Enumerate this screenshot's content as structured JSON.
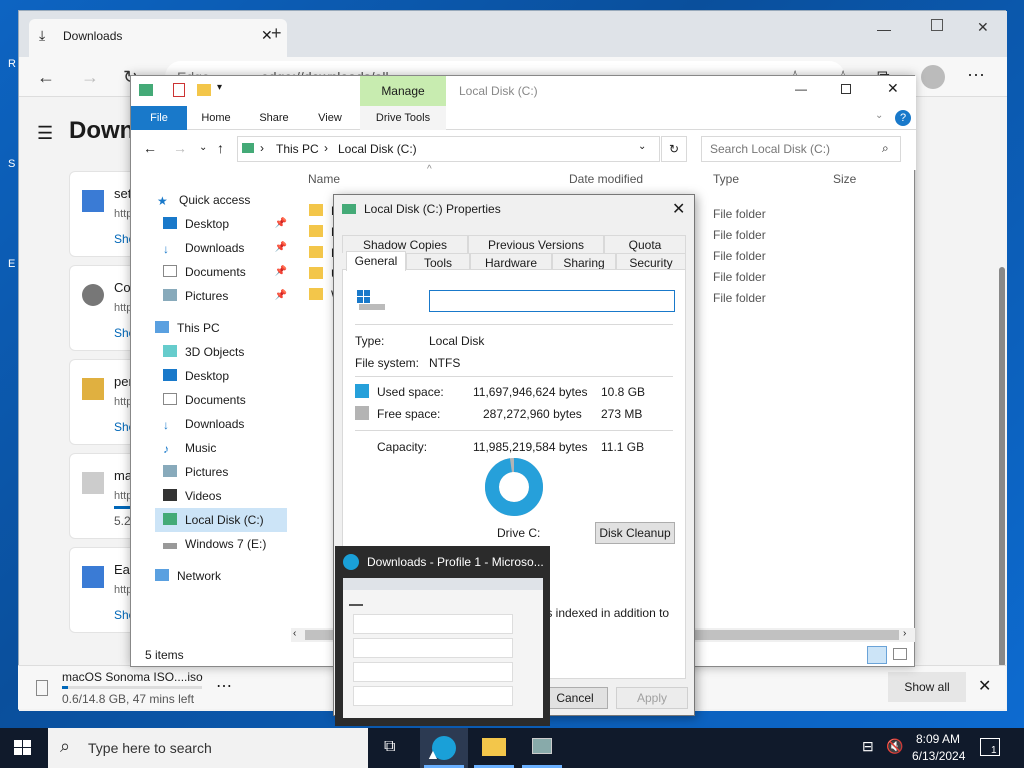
{
  "desktop": {
    "edge_letters": [
      "R",
      "S",
      "E"
    ]
  },
  "edge": {
    "tab_title": "Downloads",
    "address_prefix": "Edge",
    "address_url": "edge://downloads/all",
    "page_heading": "Down",
    "downloads": [
      {
        "name": "set",
        "url": "http",
        "link": "Sho"
      },
      {
        "name": "Co",
        "url": "http",
        "link": "Sho"
      },
      {
        "name": "per",
        "url": "http",
        "link": "Sho"
      },
      {
        "name": "ma",
        "url": "http",
        "link": "5.2"
      },
      {
        "name": "Ea",
        "url": "http",
        "link": "Sho"
      }
    ],
    "download_bar": {
      "file_name": "macOS Sonoma ISO....iso",
      "progress_text": "0.6/14.8 GB, 47 mins left",
      "progress_fraction": 0.04,
      "show_all": "Show all"
    }
  },
  "explorer": {
    "manage_label": "Manage",
    "window_title": "Local Disk (C:)",
    "ribbon_tabs": [
      "File",
      "Home",
      "Share",
      "View",
      "Drive Tools"
    ],
    "breadcrumb": [
      "This PC",
      "Local Disk (C:)"
    ],
    "search_placeholder": "Search Local Disk (C:)",
    "columns": {
      "name": "Name",
      "date": "Date modified",
      "type": "Type",
      "size": "Size"
    },
    "files": [
      {
        "name": "P",
        "type": "File folder"
      },
      {
        "name": "P",
        "type": "File folder"
      },
      {
        "name": "P",
        "type": "File folder"
      },
      {
        "name": "U",
        "type": "File folder"
      },
      {
        "name": "W",
        "type": "File folder"
      }
    ],
    "nav": {
      "quick_access": "Quick access",
      "quick_items": [
        "Desktop",
        "Downloads",
        "Documents",
        "Pictures"
      ],
      "this_pc": "This PC",
      "pc_items": [
        "3D Objects",
        "Desktop",
        "Documents",
        "Downloads",
        "Music",
        "Pictures",
        "Videos",
        "Local Disk (C:)",
        "Windows 7 (E:)"
      ],
      "network": "Network"
    },
    "status": "5 items"
  },
  "properties": {
    "title": "Local Disk (C:) Properties",
    "tabs_top": [
      "Shadow Copies",
      "Previous Versions",
      "Quota"
    ],
    "tabs_bottom": [
      "General",
      "Tools",
      "Hardware",
      "Sharing",
      "Security"
    ],
    "label_value": "",
    "type_label": "Type:",
    "type_value": "Local Disk",
    "fs_label": "File system:",
    "fs_value": "NTFS",
    "used_label": "Used space:",
    "used_bytes": "11,697,946,624 bytes",
    "used_gb": "10.8 GB",
    "free_label": "Free space:",
    "free_bytes": "287,272,960 bytes",
    "free_gb": "273 MB",
    "capacity_label": "Capacity:",
    "capacity_bytes": "11,985,219,584 bytes",
    "capacity_gb": "11.1 GB",
    "used_fraction": 0.976,
    "drive_label": "Drive C:",
    "disk_cleanup": "Disk Cleanup",
    "partial_text_1": "e",
    "partial_text_2": "ts indexed in addition to",
    "cancel": "Cancel",
    "apply": "Apply",
    "colors": {
      "used": "#26a0da",
      "free": "#b4b4b4"
    }
  },
  "preview": {
    "title": "Downloads - Profile 1 - Microso..."
  },
  "taskbar": {
    "search_placeholder": "Type here to search",
    "time": "8:09 AM",
    "date": "6/13/2024",
    "notification_count": "1"
  }
}
